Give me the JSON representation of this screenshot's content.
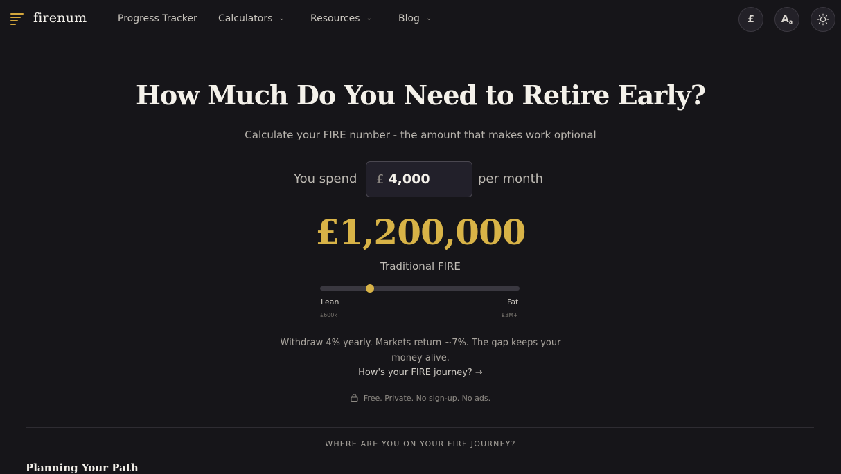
{
  "nav": {
    "brand": "firenum",
    "links": [
      "Progress Tracker",
      "Calculators",
      "Resources",
      "Blog"
    ],
    "currency_button": "£",
    "font_button": "A",
    "font_button_sub": "a"
  },
  "hero": {
    "title": "How Much Do You Need to Retire Early?",
    "subtitle": "Calculate your FIRE number - the amount that makes work optional",
    "spend_prefix": "You spend",
    "spend_currency": "£",
    "spend_value": "4,000",
    "spend_suffix": "per month",
    "fire_number": "£1,200,000",
    "fire_type": "Traditional FIRE"
  },
  "slider": {
    "value_fraction": 0.25,
    "min_label": "Lean",
    "min_value": "£600k",
    "max_label": "Fat",
    "max_value": "£3M+"
  },
  "explanation": "Withdraw 4% yearly. Markets return ~7%. The gap keeps your money alive.",
  "journey_link": "How's your FIRE journey? →",
  "privacy_note": "Free. Private. No sign-up. No ads.",
  "section": {
    "label": "WHERE ARE YOU ON YOUR FIRE JOURNEY?",
    "heading": "Planning Your Path"
  },
  "colors": {
    "accent": "#d8b347",
    "background": "#161519"
  },
  "icons": [
    "menu-icon",
    "chevron-down-icon",
    "pound-icon",
    "font-size-icon",
    "sun-icon",
    "lock-icon"
  ]
}
